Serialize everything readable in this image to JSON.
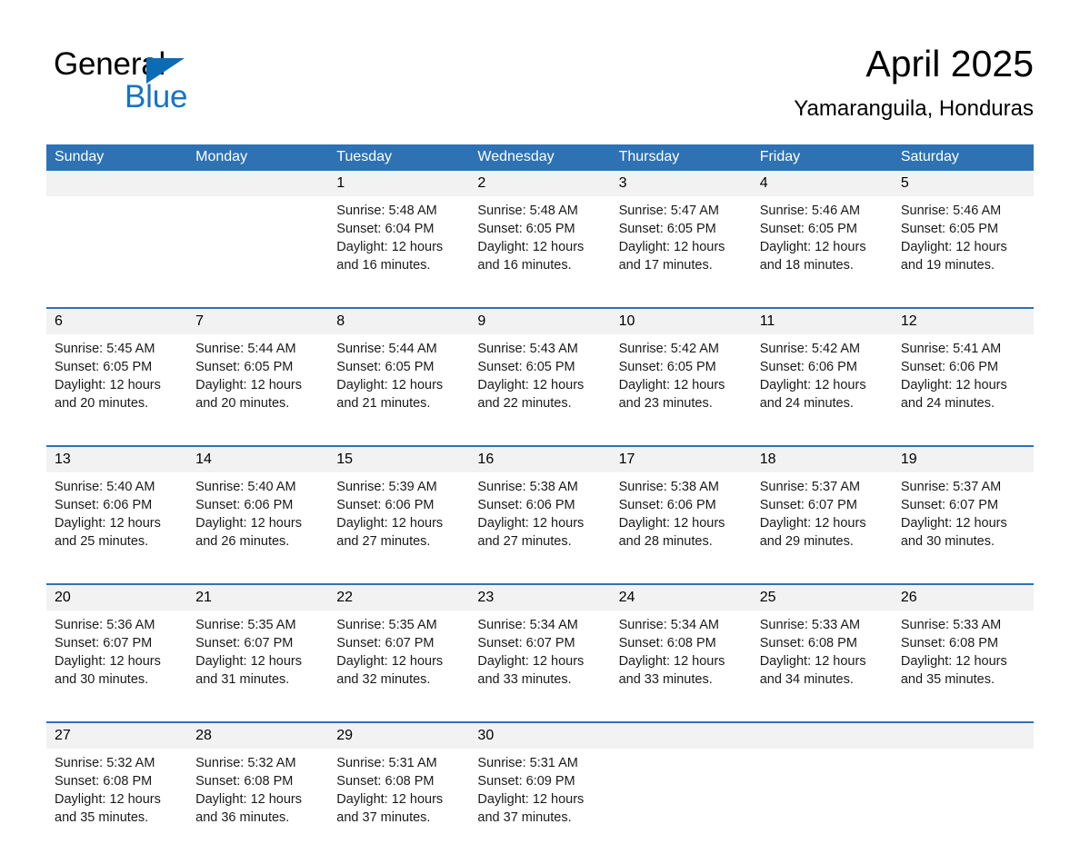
{
  "brand": {
    "word_one": "General",
    "word_two": "Blue",
    "triangle_icon": "blue-triangle-icon",
    "accent_color": "#1673c4"
  },
  "header": {
    "title": "April 2025",
    "location": "Yamaranguila, Honduras"
  },
  "calendar": {
    "header_bg": "#2e72b4",
    "daynum_bg": "#f2f2f2",
    "weekday_headers": [
      "Sunday",
      "Monday",
      "Tuesday",
      "Wednesday",
      "Thursday",
      "Friday",
      "Saturday"
    ],
    "weeks": [
      [
        {
          "day": "",
          "lines": []
        },
        {
          "day": "",
          "lines": []
        },
        {
          "day": "1",
          "lines": [
            "Sunrise: 5:48 AM",
            "Sunset: 6:04 PM",
            "Daylight: 12 hours",
            "and 16 minutes."
          ]
        },
        {
          "day": "2",
          "lines": [
            "Sunrise: 5:48 AM",
            "Sunset: 6:05 PM",
            "Daylight: 12 hours",
            "and 16 minutes."
          ]
        },
        {
          "day": "3",
          "lines": [
            "Sunrise: 5:47 AM",
            "Sunset: 6:05 PM",
            "Daylight: 12 hours",
            "and 17 minutes."
          ]
        },
        {
          "day": "4",
          "lines": [
            "Sunrise: 5:46 AM",
            "Sunset: 6:05 PM",
            "Daylight: 12 hours",
            "and 18 minutes."
          ]
        },
        {
          "day": "5",
          "lines": [
            "Sunrise: 5:46 AM",
            "Sunset: 6:05 PM",
            "Daylight: 12 hours",
            "and 19 minutes."
          ]
        }
      ],
      [
        {
          "day": "6",
          "lines": [
            "Sunrise: 5:45 AM",
            "Sunset: 6:05 PM",
            "Daylight: 12 hours",
            "and 20 minutes."
          ]
        },
        {
          "day": "7",
          "lines": [
            "Sunrise: 5:44 AM",
            "Sunset: 6:05 PM",
            "Daylight: 12 hours",
            "and 20 minutes."
          ]
        },
        {
          "day": "8",
          "lines": [
            "Sunrise: 5:44 AM",
            "Sunset: 6:05 PM",
            "Daylight: 12 hours",
            "and 21 minutes."
          ]
        },
        {
          "day": "9",
          "lines": [
            "Sunrise: 5:43 AM",
            "Sunset: 6:05 PM",
            "Daylight: 12 hours",
            "and 22 minutes."
          ]
        },
        {
          "day": "10",
          "lines": [
            "Sunrise: 5:42 AM",
            "Sunset: 6:05 PM",
            "Daylight: 12 hours",
            "and 23 minutes."
          ]
        },
        {
          "day": "11",
          "lines": [
            "Sunrise: 5:42 AM",
            "Sunset: 6:06 PM",
            "Daylight: 12 hours",
            "and 24 minutes."
          ]
        },
        {
          "day": "12",
          "lines": [
            "Sunrise: 5:41 AM",
            "Sunset: 6:06 PM",
            "Daylight: 12 hours",
            "and 24 minutes."
          ]
        }
      ],
      [
        {
          "day": "13",
          "lines": [
            "Sunrise: 5:40 AM",
            "Sunset: 6:06 PM",
            "Daylight: 12 hours",
            "and 25 minutes."
          ]
        },
        {
          "day": "14",
          "lines": [
            "Sunrise: 5:40 AM",
            "Sunset: 6:06 PM",
            "Daylight: 12 hours",
            "and 26 minutes."
          ]
        },
        {
          "day": "15",
          "lines": [
            "Sunrise: 5:39 AM",
            "Sunset: 6:06 PM",
            "Daylight: 12 hours",
            "and 27 minutes."
          ]
        },
        {
          "day": "16",
          "lines": [
            "Sunrise: 5:38 AM",
            "Sunset: 6:06 PM",
            "Daylight: 12 hours",
            "and 27 minutes."
          ]
        },
        {
          "day": "17",
          "lines": [
            "Sunrise: 5:38 AM",
            "Sunset: 6:06 PM",
            "Daylight: 12 hours",
            "and 28 minutes."
          ]
        },
        {
          "day": "18",
          "lines": [
            "Sunrise: 5:37 AM",
            "Sunset: 6:07 PM",
            "Daylight: 12 hours",
            "and 29 minutes."
          ]
        },
        {
          "day": "19",
          "lines": [
            "Sunrise: 5:37 AM",
            "Sunset: 6:07 PM",
            "Daylight: 12 hours",
            "and 30 minutes."
          ]
        }
      ],
      [
        {
          "day": "20",
          "lines": [
            "Sunrise: 5:36 AM",
            "Sunset: 6:07 PM",
            "Daylight: 12 hours",
            "and 30 minutes."
          ]
        },
        {
          "day": "21",
          "lines": [
            "Sunrise: 5:35 AM",
            "Sunset: 6:07 PM",
            "Daylight: 12 hours",
            "and 31 minutes."
          ]
        },
        {
          "day": "22",
          "lines": [
            "Sunrise: 5:35 AM",
            "Sunset: 6:07 PM",
            "Daylight: 12 hours",
            "and 32 minutes."
          ]
        },
        {
          "day": "23",
          "lines": [
            "Sunrise: 5:34 AM",
            "Sunset: 6:07 PM",
            "Daylight: 12 hours",
            "and 33 minutes."
          ]
        },
        {
          "day": "24",
          "lines": [
            "Sunrise: 5:34 AM",
            "Sunset: 6:08 PM",
            "Daylight: 12 hours",
            "and 33 minutes."
          ]
        },
        {
          "day": "25",
          "lines": [
            "Sunrise: 5:33 AM",
            "Sunset: 6:08 PM",
            "Daylight: 12 hours",
            "and 34 minutes."
          ]
        },
        {
          "day": "26",
          "lines": [
            "Sunrise: 5:33 AM",
            "Sunset: 6:08 PM",
            "Daylight: 12 hours",
            "and 35 minutes."
          ]
        }
      ],
      [
        {
          "day": "27",
          "lines": [
            "Sunrise: 5:32 AM",
            "Sunset: 6:08 PM",
            "Daylight: 12 hours",
            "and 35 minutes."
          ]
        },
        {
          "day": "28",
          "lines": [
            "Sunrise: 5:32 AM",
            "Sunset: 6:08 PM",
            "Daylight: 12 hours",
            "and 36 minutes."
          ]
        },
        {
          "day": "29",
          "lines": [
            "Sunrise: 5:31 AM",
            "Sunset: 6:08 PM",
            "Daylight: 12 hours",
            "and 37 minutes."
          ]
        },
        {
          "day": "30",
          "lines": [
            "Sunrise: 5:31 AM",
            "Sunset: 6:09 PM",
            "Daylight: 12 hours",
            "and 37 minutes."
          ]
        },
        {
          "day": "",
          "lines": []
        },
        {
          "day": "",
          "lines": []
        },
        {
          "day": "",
          "lines": []
        }
      ]
    ]
  }
}
